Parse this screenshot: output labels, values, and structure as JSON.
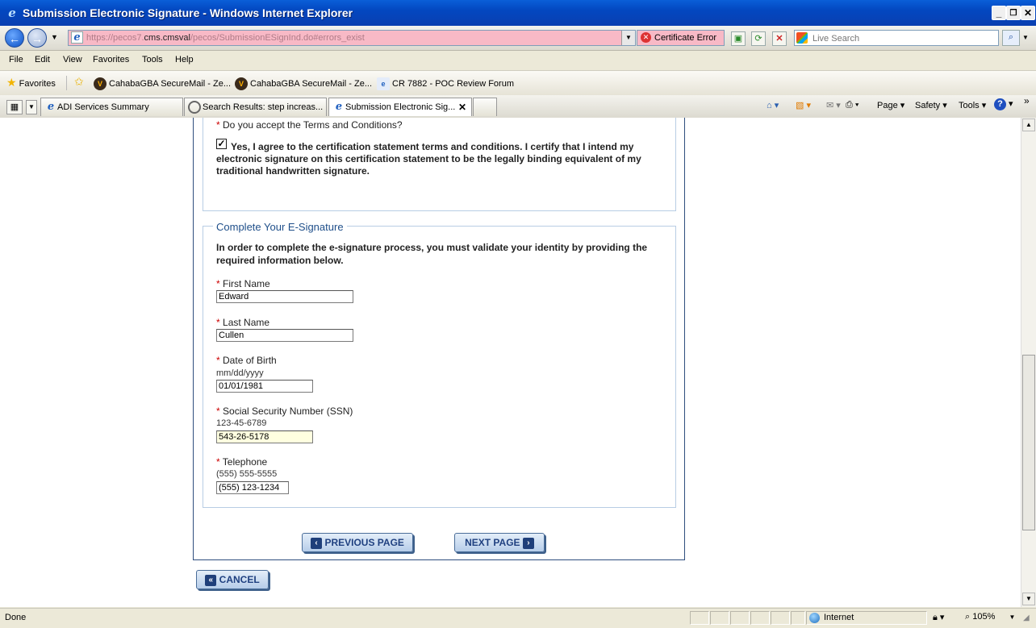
{
  "window": {
    "title": "Submission Electronic Signature - Windows Internet Explorer",
    "min": "_",
    "max": "̲□",
    "close": "X"
  },
  "address": {
    "url_prefix": "https://pecos7.",
    "url_host": "cms.cmsval",
    "url_rest": "/pecos/SubmissionESignInd.do#errors_exist",
    "cert_error": "Certificate Error",
    "search_placeholder": "Live Search"
  },
  "menu": [
    "File",
    "Edit",
    "View",
    "Favorites",
    "Tools",
    "Help"
  ],
  "favorites": {
    "label": "Favorites",
    "links": [
      "CahabaGBA SecureMail - Ze...",
      "CahabaGBA SecureMail - Ze...",
      "CR 7882 - POC Review Forum"
    ]
  },
  "tabs": [
    "ADI Services Summary",
    "Search Results: step increas...",
    "Submission Electronic Sig..."
  ],
  "commands": {
    "page": "Page",
    "safety": "Safety",
    "tools": "Tools"
  },
  "form": {
    "terms_question": "Do you accept the Terms and Conditions?",
    "terms_checked": true,
    "terms_text": "Yes, I agree to the certification statement terms and conditions. I certify that I intend my electronic signature on this certification statement to be the legally binding equivalent of my traditional handwritten signature.",
    "esig_legend": "Complete Your E-Signature",
    "esig_intro": "In order to complete the e-signature process, you must validate your identity by providing the required information below.",
    "required_mark": "*",
    "first_name": {
      "label": "First Name",
      "value": "Edward"
    },
    "last_name": {
      "label": "Last Name",
      "value": "Cullen"
    },
    "dob": {
      "label": "Date of Birth",
      "hint": "mm/dd/yyyy",
      "value": "01/01/1981"
    },
    "ssn": {
      "label": "Social Security Number (SSN)",
      "hint": "123-45-6789",
      "value": "543-26-5178"
    },
    "phone": {
      "label": "Telephone",
      "hint": "(555) 555-5555",
      "value": "(555) 123-1234"
    },
    "prev_button": "PREVIOUS PAGE",
    "next_button": "NEXT PAGE",
    "cancel_button": "CANCEL"
  },
  "status": {
    "text": "Done",
    "zone": "Internet",
    "zoom": "105%"
  },
  "colors": {
    "titlebar": "#0347c0",
    "address_error": "#f8b9c6",
    "heading_blue": "#1f4f8a",
    "required_red": "#cc0000"
  }
}
